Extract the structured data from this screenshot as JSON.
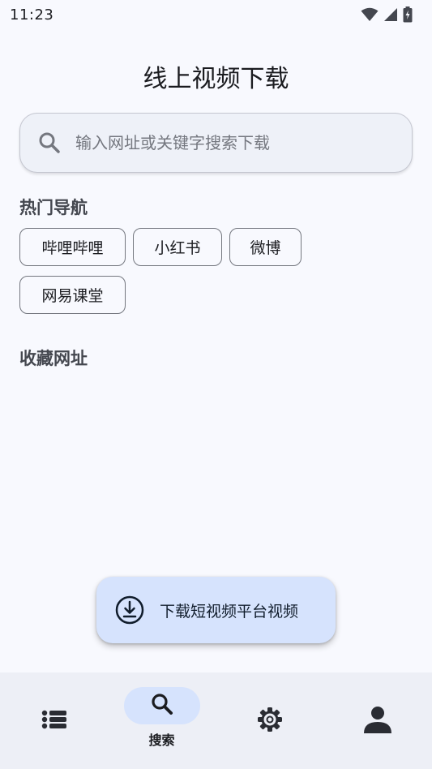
{
  "status_bar": {
    "time": "11:23",
    "icons": [
      "wifi-icon",
      "cell-signal-icon",
      "battery-charging-icon"
    ]
  },
  "page": {
    "title": "线上视频下载"
  },
  "search": {
    "placeholder": "输入网址或关键字搜索下载",
    "value": ""
  },
  "hot_nav": {
    "title": "热门导航",
    "items": [
      {
        "label": "哔哩哔哩"
      },
      {
        "label": "小红书"
      },
      {
        "label": "微博"
      },
      {
        "label": "网易课堂"
      }
    ]
  },
  "favorites": {
    "title": "收藏网址"
  },
  "fab": {
    "label": "下载短视频平台视频",
    "icon": "download-circle-icon"
  },
  "bottom_nav": {
    "items": [
      {
        "icon": "list-icon",
        "label": ""
      },
      {
        "icon": "search-icon",
        "label": "搜索",
        "active": true
      },
      {
        "icon": "gear-icon",
        "label": ""
      },
      {
        "icon": "person-icon",
        "label": ""
      }
    ]
  },
  "colors": {
    "background": "#f8f9fe",
    "accent_container": "#d6e3fd",
    "nav_background": "#edeff6",
    "outline": "#74777f"
  }
}
